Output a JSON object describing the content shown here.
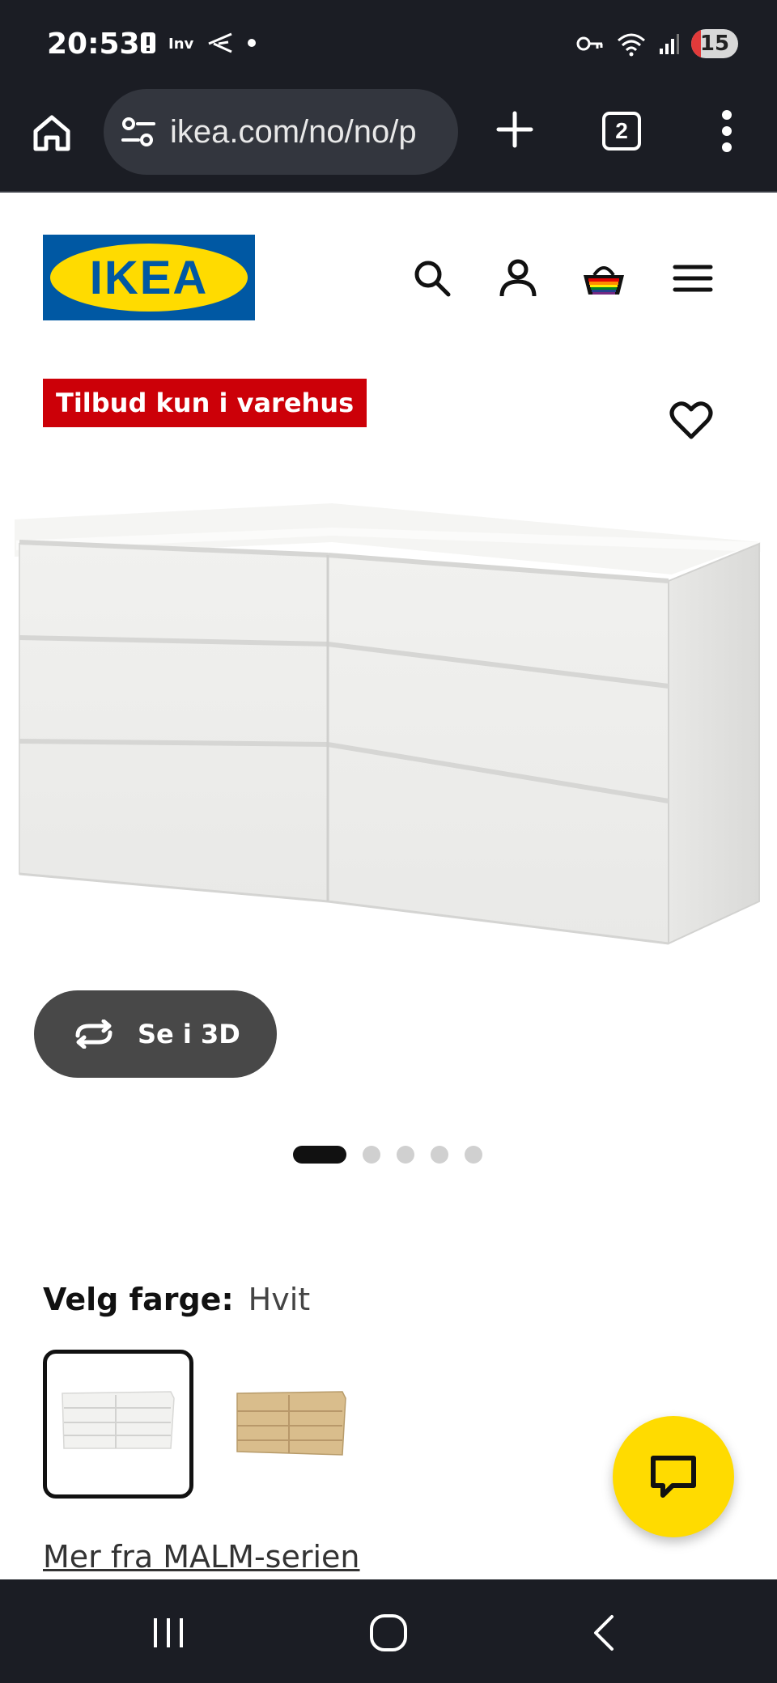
{
  "status_bar": {
    "time": "20:53",
    "left_icons": [
      "alert-icon",
      "app-notification-icon",
      "wing-app-icon",
      "dot-icon"
    ],
    "right_icons": [
      "key-icon",
      "wifi-icon",
      "signal-icon"
    ],
    "battery_level": "15",
    "battery_fraction": 0.15
  },
  "browser": {
    "url": "ikea.com/no/no/p",
    "tab_count": "2"
  },
  "header": {
    "logo_text": "IKEA"
  },
  "product": {
    "promo_badge": "Tilbud kun i varehus",
    "view_3d_label": "Se i 3D",
    "carousel": {
      "total": 5,
      "active_index": 0
    },
    "color_label": "Velg farge:",
    "color_value": "Hvit",
    "swatches": [
      "white-dresser-swatch",
      "oak-dresser-swatch"
    ],
    "series_link": "Mer fra MALM-serien"
  },
  "colors": {
    "ikea_blue": "#0058a3",
    "ikea_yellow": "#ffdb00",
    "promo_red": "#cc0008",
    "dark_bar": "#1b1d24"
  }
}
